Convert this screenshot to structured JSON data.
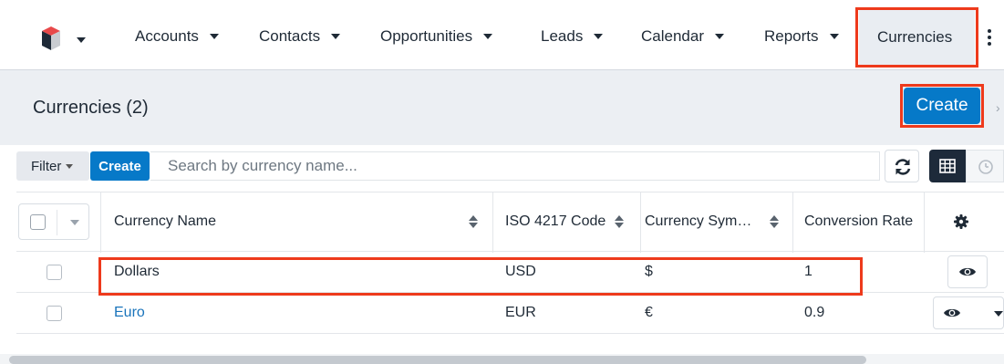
{
  "nav": {
    "items": [
      {
        "label": "Accounts"
      },
      {
        "label": "Contacts"
      },
      {
        "label": "Opportunities"
      },
      {
        "label": "Leads"
      },
      {
        "label": "Calendar"
      },
      {
        "label": "Reports"
      }
    ],
    "active": "Currencies",
    "more_icon": "vertical-ellipsis-icon"
  },
  "header": {
    "title": "Currencies (2)",
    "create_label": "Create"
  },
  "filter": {
    "filter_label": "Filter",
    "create_label": "Create",
    "search_placeholder": "Search by currency name..."
  },
  "table": {
    "columns": [
      "Currency Name",
      "ISO 4217 Code",
      "Currency Sym…",
      "Conversion Rate"
    ],
    "rows": [
      {
        "name": "Dollars",
        "code": "USD",
        "symbol": "$",
        "rate": "1"
      },
      {
        "name": "Euro",
        "code": "EUR",
        "symbol": "€",
        "rate": "0.9"
      }
    ]
  },
  "colors": {
    "primary": "#0679c8",
    "highlight": "#ee3a1c",
    "link": "#1a74bb"
  }
}
